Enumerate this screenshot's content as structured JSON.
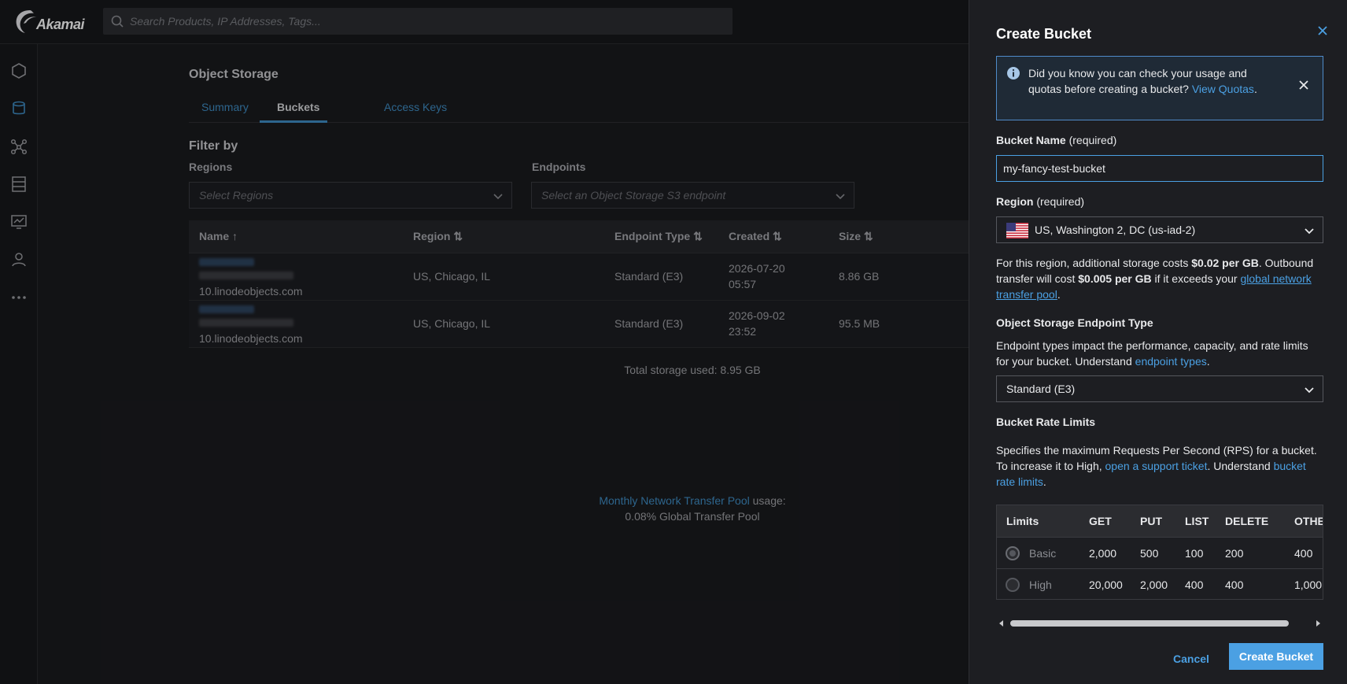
{
  "app": {
    "brand": "Akamai",
    "search_placeholder": "Search Products, IP Addresses, Tags..."
  },
  "sidenav": {
    "items": [
      {
        "icon": "cube-icon"
      },
      {
        "icon": "database-icon"
      },
      {
        "icon": "network-icon"
      },
      {
        "icon": "server-icon"
      },
      {
        "icon": "monitor-icon"
      },
      {
        "icon": "user-icon"
      },
      {
        "icon": "more-icon"
      }
    ]
  },
  "page": {
    "title": "Object Storage",
    "tabs": [
      {
        "label": "Summary"
      },
      {
        "label": "Buckets",
        "active": true
      },
      {
        "label": "Access Keys"
      }
    ],
    "filter": {
      "title": "Filter by",
      "regions_label": "Regions",
      "regions_placeholder": "Select Regions",
      "endpoints_label": "Endpoints",
      "endpoints_placeholder": "Select an Object Storage S3 endpoint"
    },
    "table": {
      "headers": [
        "Name ↑",
        "Region ⇅",
        "Endpoint Type ⇅",
        "Created ⇅",
        "Size ⇅"
      ],
      "rows": [
        {
          "name_suffix": "10.linodeobjects.com",
          "region": "US, Chicago, IL",
          "endpoint": "Standard (E3)",
          "created_date": "2026-07-20",
          "created_time": "05:57",
          "size": "8.86 GB"
        },
        {
          "name_suffix": "10.linodeobjects.com",
          "region": "US, Chicago, IL",
          "endpoint": "Standard (E3)",
          "created_date": "2026-09-02",
          "created_time": "23:52",
          "size": "95.5 MB"
        }
      ]
    },
    "total_storage": "Total storage used: 8.95 GB",
    "transfer": {
      "link": "Monthly Network Transfer Pool",
      "suffix": " usage:",
      "line2": "0.08% Global Transfer Pool"
    }
  },
  "drawer": {
    "title": "Create Bucket",
    "notice": {
      "text": "Did you know you can check your usage and quotas before creating a bucket? ",
      "link": "View Quotas",
      "end": "."
    },
    "bucket_name": {
      "label": "Bucket Name",
      "req": " (required)",
      "value": "my-fancy-test-bucket"
    },
    "region": {
      "label": "Region",
      "req": " (required)",
      "value": "US, Washington 2, DC (us-iad-2)"
    },
    "region_info": {
      "t1": "For this region, additional storage costs ",
      "b1": "$0.02 per GB",
      "t2": ". Outbound transfer will cost ",
      "b2": "$0.005 per GB",
      "t3": " if it exceeds your ",
      "link": "global network transfer pool",
      "t4": "."
    },
    "endpoint": {
      "heading": "Object Storage Endpoint Type",
      "desc": "Endpoint types impact the performance, capacity, and rate limits for your bucket. Understand ",
      "link": "endpoint types",
      "end": ".",
      "value": "Standard (E3)"
    },
    "rate_limits": {
      "heading": "Bucket Rate Limits",
      "d1": "Specifies the maximum Requests Per Second (RPS) for a bucket. To increase it to High, ",
      "link1": "open a support ticket",
      "d2": ". Understand ",
      "link2": "bucket rate limits",
      "d3": ".",
      "headers": [
        "Limits",
        "GET",
        "PUT",
        "LIST",
        "DELETE",
        "OTHER"
      ],
      "rows": [
        {
          "name": "Basic",
          "values": [
            "2,000",
            "500",
            "100",
            "200",
            "400"
          ],
          "selected": true
        },
        {
          "name": "High",
          "values": [
            "20,000",
            "2,000",
            "400",
            "400",
            "1,000"
          ],
          "selected": false
        }
      ]
    },
    "buttons": {
      "cancel": "Cancel",
      "create": "Create Bucket"
    },
    "colors": {
      "accent": "#4ba0e3",
      "background": "#1d1e22"
    }
  }
}
